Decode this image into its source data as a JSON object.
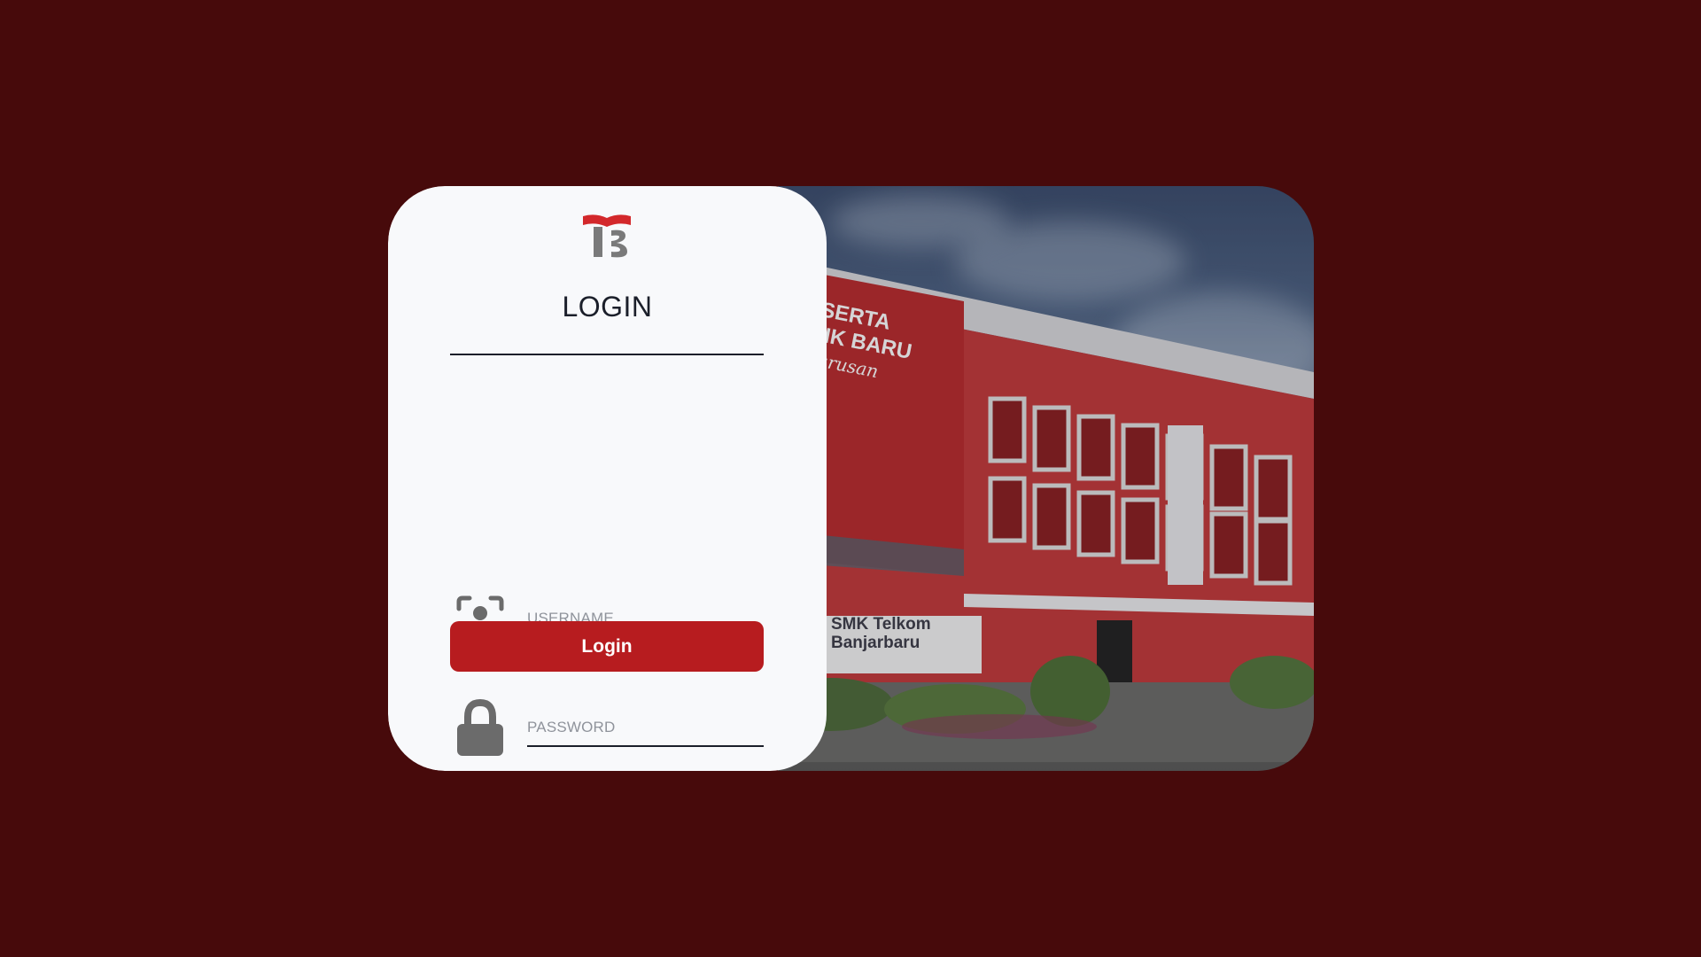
{
  "login": {
    "title": "LOGIN",
    "username_placeholder": "USERNAME",
    "password_placeholder": "PASSWORD",
    "button_label": "Login"
  },
  "icons": {
    "logo": "school-logo-icon",
    "username": "user-scan-icon",
    "password": "lock-icon"
  },
  "colors": {
    "page_background": "#470a0b",
    "panel_background": "#f8f9fb",
    "button_background": "#b71c1f",
    "icon_gray": "#6b6b6b"
  },
  "photo": {
    "banner_lines": [
      "PESERTA",
      "DIDIK BARU"
    ],
    "banner_script": "Jurusan",
    "sign_lines": [
      "SMK Telkom",
      "Banjarbaru"
    ]
  }
}
